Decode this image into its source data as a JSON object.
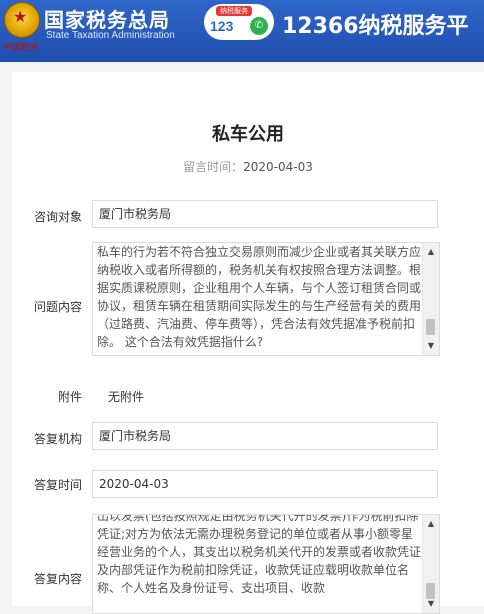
{
  "header": {
    "logo_cn": "国家税务总局",
    "logo_en": "State Taxation Administration",
    "logo_sub": "中国税务",
    "badge_tag": "纳税服务",
    "badge_num": "123",
    "emblem_icon": "national-emblem",
    "phone_icon": "phone",
    "service_title": "12366纳税服务平",
    "colors": {
      "header": "#2559be",
      "emblem_star": "#c0100b",
      "phone": "#2db34a"
    }
  },
  "page": {
    "title": "私车公用",
    "msg_time_label": "留言时间：",
    "msg_time_value": "2020-04-03"
  },
  "form": {
    "target_label": "咨询对象",
    "target_value": "厦门市税务局",
    "question_label": "问题内容",
    "question_text": "私车的行为若不符合独立交易原则而减少企业或者其关联方应纳税收入或者所得额的，税务机关有权按照合理方法调整。根据实质课税原则，企业租用个人车辆，与个人签订租赁合同或协议，租赁车辆在租赁期间实际发生的与生产经营有关的费用（过路费、汽油费、停车费等），凭合法有效凭据准予税前扣除。 这个合法有效凭据指什么?",
    "attachment_label": "附件",
    "attachment_value": "无附件",
    "reply_org_label": "答复机构",
    "reply_org_value": "厦门市税务局",
    "reply_time_label": "答复时间",
    "reply_time_value": "2020-04-03",
    "reply_content_label": "答复内容",
    "reply_text": "出以发票(包括按照规定由税务机关代开的发票)作为税前扣除凭证;对方为依法无需办理税务登记的单位或者从事小额零星经营业务的个人，其支出以税务机关代开的发票或者收款凭证及内部凭证作为税前扣除凭证，收款凭证应载明收款单位名称、个人姓名及身份证号、支出项目、收款"
  }
}
